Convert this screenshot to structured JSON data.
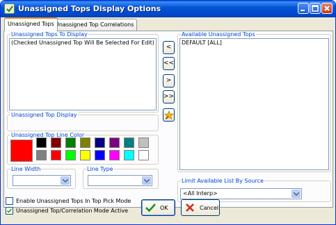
{
  "window": {
    "title": "Unassigned Tops Display Options",
    "minimize_label": "minimize",
    "maximize_label": "maximize",
    "close_label": "close"
  },
  "tabs": [
    {
      "label": "Unassigned Tops",
      "active": true
    },
    {
      "label": "Unassigned Top Correlations",
      "active": false
    }
  ],
  "left": {
    "display_group_label": "Unassigned Tops To Display",
    "display_list_hint": "(Checked Unassigned Top Will Be Selected For Edit)",
    "top_display_label": "Unassigned Top Display",
    "line_color_label": "Unassigned Top Line Color",
    "selected_color": "#ff0000",
    "palette": [
      "#000000",
      "#800000",
      "#008000",
      "#808000",
      "#000080",
      "#800080",
      "#008080",
      "#c0c0c0",
      "#808080",
      "#ff0000",
      "#00ff00",
      "#ffff00",
      "#0000ff",
      "#ff00ff",
      "#00ffff",
      "#ffffff"
    ],
    "line_width_label": "Line Width",
    "line_width_value": "",
    "line_type_label": "Line Type",
    "line_type_value": ""
  },
  "transfer_buttons": {
    "move_left": "<",
    "move_all_left": "<<",
    "move_right": ">",
    "move_all_right": ">>",
    "special_icon": "star-edit-icon"
  },
  "right": {
    "available_label": "Available Unassigned Tops",
    "available_items": [
      "DEFAULT [ALL]"
    ],
    "limit_label": "Limit Available List By Source",
    "limit_value": "<All Interp>"
  },
  "footer": {
    "enable_pick_label": "Enable Unassigned Tops In Top Pick Mode",
    "enable_pick_checked": false,
    "correlation_active_label": "Unassigned Top/Correlation Mode Active",
    "correlation_active_checked": true,
    "ok_label": "OK",
    "cancel_label": "Cancel"
  }
}
